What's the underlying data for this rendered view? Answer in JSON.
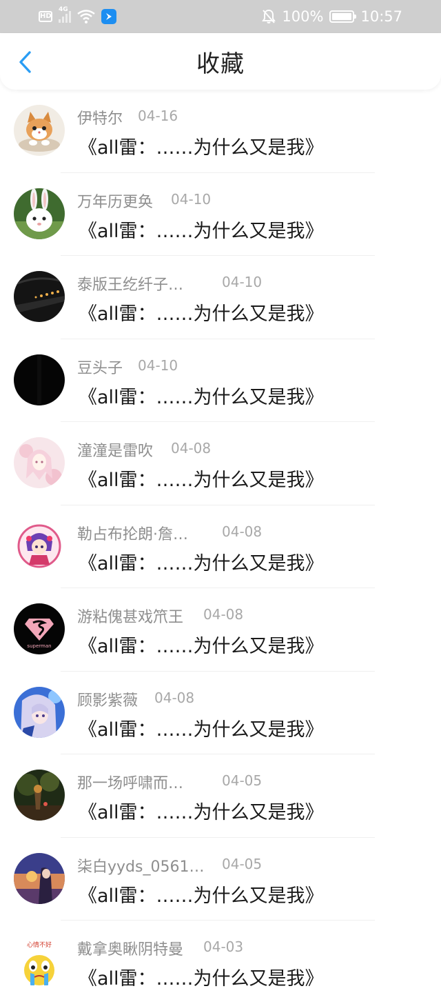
{
  "status_bar": {
    "hd": "HD",
    "network": "4G",
    "battery_percent": "100%",
    "time": "10:57",
    "icons": [
      "hd-icon",
      "signal-icon",
      "wifi-icon",
      "app-notification-icon",
      "mute-icon",
      "battery-icon"
    ]
  },
  "header": {
    "title": "收藏",
    "back_icon": "chevron-left-icon"
  },
  "colors": {
    "accent": "#2a9df4",
    "status_bar_bg": "#cfcfcf",
    "name_text": "#8e8e8e",
    "message_text": "#1a1a1a"
  },
  "items": [
    {
      "name": "伊特尔",
      "date": "04-16",
      "message": "《all雷：……为什么又是我》",
      "avatar": "kitten-avatar"
    },
    {
      "name": "万年历更奂",
      "date": "04-10",
      "message": "《all雷：……为什么又是我》",
      "avatar": "rabbit-avatar"
    },
    {
      "name": "泰版王纥纤子…",
      "date": "04-10",
      "message": "《all雷：……为什么又是我》",
      "avatar": "tunnel-avatar"
    },
    {
      "name": "豆头子",
      "date": "04-10",
      "message": "《all雷：……为什么又是我》",
      "avatar": "black-avatar"
    },
    {
      "name": "潼潼是雷吹",
      "date": "04-08",
      "message": "《all雷：……为什么又是我》",
      "avatar": "anime-pink-avatar"
    },
    {
      "name": "勒占布抡朗·詹…",
      "date": "04-08",
      "message": "《all雷：……为什么又是我》",
      "avatar": "anime-chibi-avatar"
    },
    {
      "name": "游粘傀甚戏笊王",
      "date": "04-08",
      "message": "《all雷：……为什么又是我》",
      "avatar": "superman-avatar"
    },
    {
      "name": "顾影紫薇",
      "date": "04-08",
      "message": "《all雷：……为什么又是我》",
      "avatar": "anime-blue-avatar"
    },
    {
      "name": "那一场呼啸而…",
      "date": "04-05",
      "message": "《all雷：……为什么又是我》",
      "avatar": "forest-avatar"
    },
    {
      "name": "柒白yyds_0561…",
      "date": "04-05",
      "message": "《all雷：……为什么又是我》",
      "avatar": "sunset-avatar"
    },
    {
      "name": "戴拿奥瞅阴特曼",
      "date": "04-03",
      "message": "《all雷：……为什么又是我》",
      "avatar": "emoji-yellow-avatar"
    }
  ],
  "superman_text": "superman",
  "emoji_caption": "心情不好"
}
